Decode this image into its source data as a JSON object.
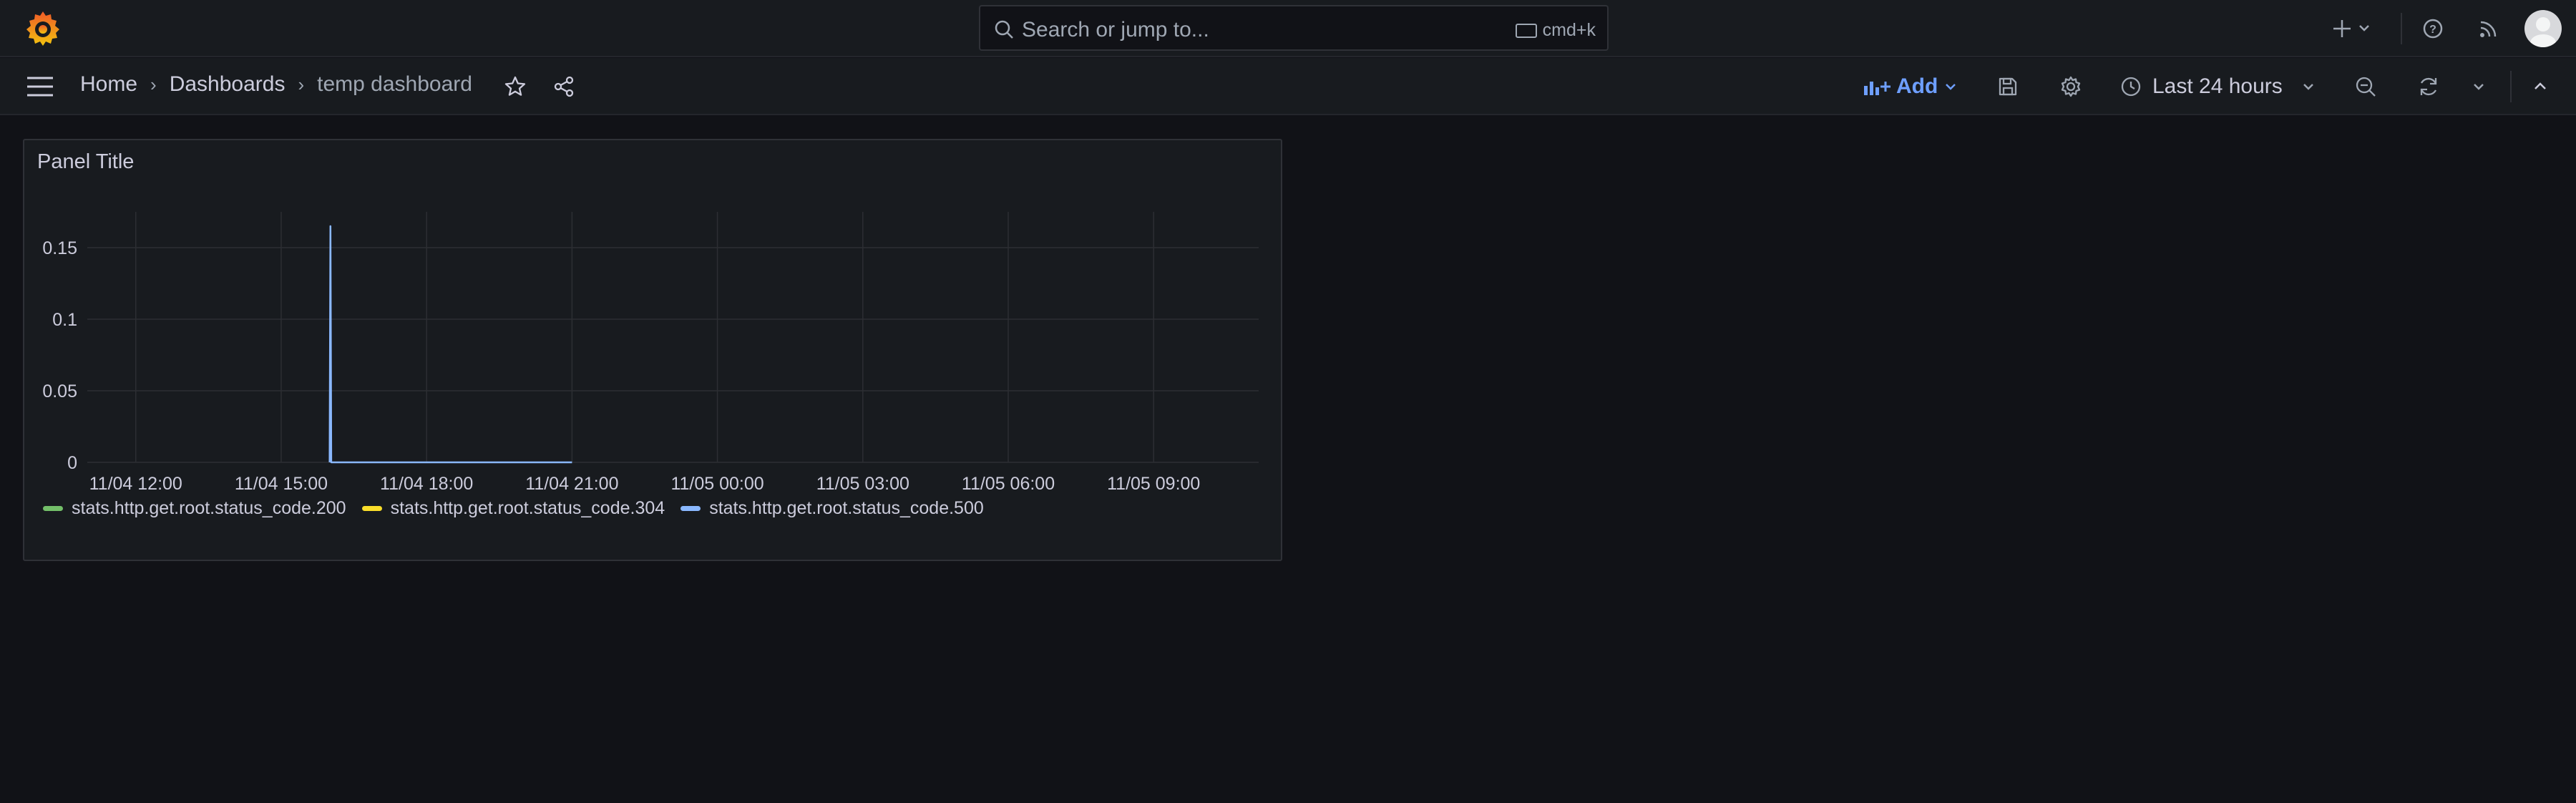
{
  "topbar": {
    "search_placeholder": "Search or jump to...",
    "search_shortcut": "cmd+k"
  },
  "nav": {
    "breadcrumbs": [
      "Home",
      "Dashboards",
      "temp dashboard"
    ],
    "add_label": "Add",
    "time_range": "Last 24 hours"
  },
  "panel": {
    "title": "Panel Title"
  },
  "colors": {
    "series_200": "#73bf69",
    "series_304": "#fade2a",
    "series_500": "#8ab8ff",
    "accent": "#6e9fff"
  },
  "chart_data": {
    "type": "line",
    "title": "Panel Title",
    "x_ticks": [
      "11/04 12:00",
      "11/04 15:00",
      "11/04 18:00",
      "11/04 21:00",
      "11/05 00:00",
      "11/05 03:00",
      "11/05 06:00",
      "11/05 09:00"
    ],
    "y_ticks": [
      "0",
      "0.05",
      "0.1",
      "0.15"
    ],
    "ylim": [
      0,
      0.175
    ],
    "x_range": [
      "11/04 11:00",
      "11/05 11:10"
    ],
    "grid": true,
    "legend_position": "bottom-left",
    "series": [
      {
        "name": "stats.http.get.root.status_code.200",
        "color": "#73bf69",
        "points": []
      },
      {
        "name": "stats.http.get.root.status_code.304",
        "color": "#fade2a",
        "points": []
      },
      {
        "name": "stats.http.get.root.status_code.500",
        "color": "#8ab8ff",
        "points": [
          [
            "11/04 16:00",
            0
          ],
          [
            "11/04 16:01",
            0.165
          ],
          [
            "11/04 16:02",
            0
          ],
          [
            "11/04 21:00",
            0
          ]
        ]
      }
    ]
  }
}
